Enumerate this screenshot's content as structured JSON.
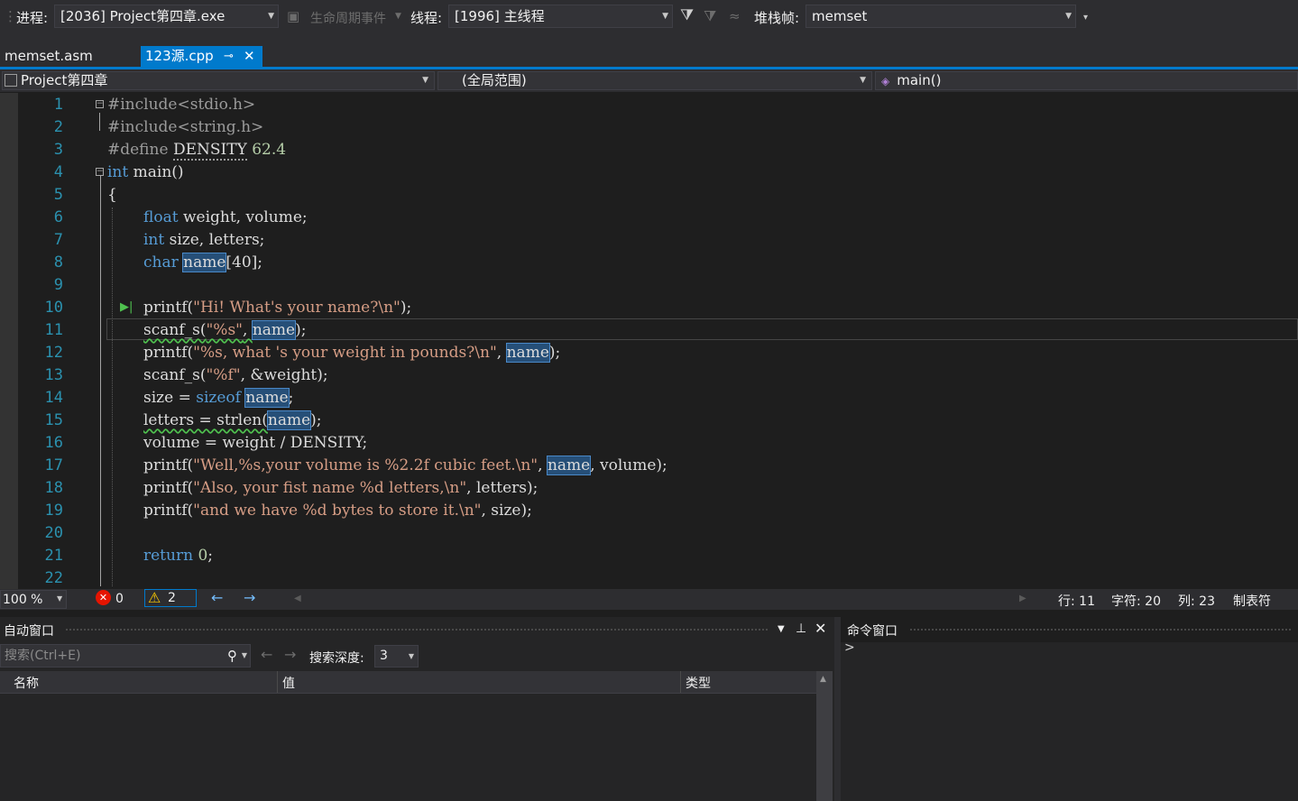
{
  "toolbar": {
    "process_label": "进程:",
    "process_value": "[2036] Project第四章.exe",
    "lifecycle_label": "生命周期事件",
    "thread_label": "线程:",
    "thread_value": "[1996] 主线程",
    "stackframe_label": "堆栈帧:",
    "stackframe_value": "memset"
  },
  "tabs": [
    {
      "label": "memset.asm",
      "active": false
    },
    {
      "label": "123源.cpp",
      "active": true
    }
  ],
  "navbar": {
    "project": "Project第四章",
    "scope": "(全局范围)",
    "member": "main()"
  },
  "editor": {
    "line_numbers": [
      "1",
      "2",
      "3",
      "4",
      "5",
      "6",
      "7",
      "8",
      "9",
      "10",
      "11",
      "12",
      "13",
      "14",
      "15",
      "16",
      "17",
      "18",
      "19",
      "20",
      "21",
      "22"
    ],
    "lines": {
      "l1_a": "#include<stdio.h>",
      "l2_a": "#include<string.h>",
      "l3_a": "#define ",
      "l3_b": "DENSITY",
      "l3_c": " 62.4",
      "l4_a": "int",
      "l4_b": " main()",
      "l5_a": "{",
      "l6_a": "float",
      "l6_b": " weight, volume;",
      "l7_a": "int",
      "l7_b": " size, letters;",
      "l8_a": "char",
      "l8_b": "name",
      "l8_c": "[40];",
      "l10_a": "printf(",
      "l10_b": "\"Hi! What's your name?\\n\"",
      "l10_c": ");",
      "l11_a": "scanf_s(",
      "l11_b": "\"%s\"",
      "l11_c": ", ",
      "l11_d": "name",
      "l11_e": ");",
      "l12_a": "printf(",
      "l12_b": "\"%s, what 's your weight in pounds?\\n\"",
      "l12_c": ", ",
      "l12_d": "name",
      "l12_e": ");",
      "l13_a": "scanf_s(",
      "l13_b": "\"%f\"",
      "l13_c": ", &weight);",
      "l14_a": "size = ",
      "l14_b": "sizeof",
      "l14_c": "name",
      "l14_d": ";",
      "l15_a": "letters = strlen(",
      "l15_b": "name",
      "l15_c": ");",
      "l16_a": "volume = weight / DENSITY;",
      "l17_a": "printf(",
      "l17_b": "\"Well,%s,your volume is %2.2f cubic feet.\\n\"",
      "l17_c": ", ",
      "l17_d": "name",
      "l17_e": ", volume);",
      "l18_a": "printf(",
      "l18_b": "\"Also, your fist name %d letters,\\n\"",
      "l18_c": ", letters);",
      "l19_a": "printf(",
      "l19_b": "\"and we have %d bytes to store it.\\n\"",
      "l19_c": ", size);",
      "l21_a": "return",
      "l21_b": "0",
      "l21_c": ";"
    }
  },
  "statusbar": {
    "zoom": "100 %",
    "errors": "0",
    "warnings": "2",
    "line": "行: 11",
    "char": "字符: 20",
    "col": "列: 23",
    "tabs": "制表符"
  },
  "auto_window": {
    "title": "自动窗口",
    "search_placeholder": "搜索(Ctrl+E)",
    "depth_label": "搜索深度:",
    "depth_value": "3",
    "columns": [
      "名称",
      "值",
      "类型"
    ]
  },
  "command_window": {
    "title": "命令窗口",
    "prompt": ">"
  }
}
